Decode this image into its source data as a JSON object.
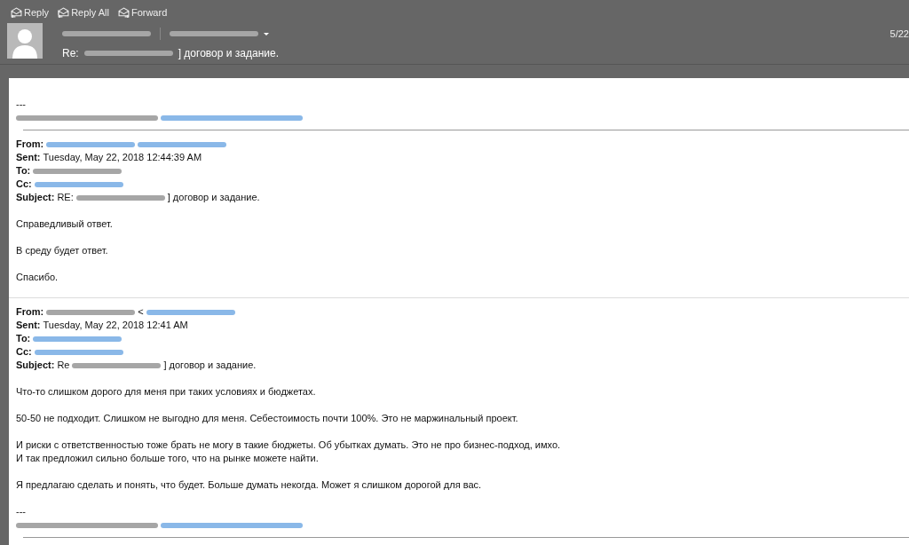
{
  "toolbar": {
    "actions": [
      {
        "label": "Reply",
        "kind": "reply"
      },
      {
        "label": "Reply All",
        "kind": "reply-all"
      },
      {
        "label": "Forward",
        "kind": "forward"
      }
    ]
  },
  "header": {
    "sender": {
      "color": "#a6a6a6"
    },
    "recipient": {
      "color": "#a6a6a6"
    },
    "subject": [
      {
        "kind": "text",
        "text": "Re:"
      },
      {
        "kind": "redacted",
        "color": "#a6a6a6"
      },
      {
        "kind": "text",
        "text": "] договор и задание."
      }
    ],
    "date": "5/22"
  },
  "signature_top": {
    "dashes": "---",
    "line": [
      {
        "kind": "redacted",
        "color": "#a6a6a6"
      },
      {
        "kind": "redacted",
        "color": "#8ab8e8"
      }
    ]
  },
  "messages": [
    {
      "fields": [
        {
          "label": "From:",
          "value": [
            {
              "kind": "redacted",
              "color": "#8ab8e8"
            },
            {
              "kind": "redacted",
              "color": "#8ab8e8"
            }
          ]
        },
        {
          "label": "Sent:",
          "value": [
            {
              "kind": "text",
              "text": "Tuesday, May 22, 2018 12:44:39 AM"
            }
          ]
        },
        {
          "label": "To:",
          "value": [
            {
              "kind": "redacted",
              "color": "#a6a6a6"
            }
          ]
        },
        {
          "label": "Cc:",
          "value": [
            {
              "kind": "redacted",
              "color": "#8ab8e8"
            }
          ]
        },
        {
          "label": "Subject:",
          "value": [
            {
              "kind": "text",
              "text": "RE:"
            },
            {
              "kind": "redacted",
              "color": "#a6a6a6"
            },
            {
              "kind": "text",
              "text": "] договор и задание."
            }
          ]
        }
      ],
      "paragraphs": [
        [
          "Справедливый ответ."
        ],
        [
          "В среду будет ответ."
        ],
        [
          "Спасибо."
        ]
      ]
    },
    {
      "fields": [
        {
          "label": "From:",
          "value": [
            {
              "kind": "redacted",
              "color": "#a6a6a6"
            },
            {
              "kind": "text",
              "text": "<"
            },
            {
              "kind": "redacted",
              "color": "#8ab8e8"
            }
          ]
        },
        {
          "label": "Sent:",
          "value": [
            {
              "kind": "text",
              "text": "Tuesday, May 22, 2018 12:41 AM"
            }
          ]
        },
        {
          "label": "To:",
          "value": [
            {
              "kind": "redacted",
              "color": "#8ab8e8"
            }
          ]
        },
        {
          "label": "Cc:",
          "value": [
            {
              "kind": "redacted",
              "color": "#8ab8e8"
            }
          ]
        },
        {
          "label": "Subject:",
          "value": [
            {
              "kind": "text",
              "text": "Re"
            },
            {
              "kind": "redacted",
              "color": "#a6a6a6"
            },
            {
              "kind": "text",
              "text": "] договор и задание."
            }
          ]
        }
      ],
      "paragraphs": [
        [
          "Что-то слишком дорого для меня при таких условиях и бюджетах."
        ],
        [
          "50-50 не подходит. Слишком не выгодно для меня. Себестоимость почти 100%. Это не маржинальный проект."
        ],
        [
          "И риски с ответственностью тоже брать не могу в такие бюджеты. Об убытках думать. Это не про бизнес-подход, имхо.",
          "И так предложил сильно больше того, что на рынке можете найти."
        ],
        [
          "Я предлагаю сделать и понять, что будет. Больше думать некогда. Может я слишком дорогой для вас."
        ]
      ],
      "signature": {
        "dashes": "---",
        "line": [
          {
            "kind": "redacted",
            "color": "#a6a6a6"
          },
          {
            "kind": "redacted",
            "color": "#8ab8e8"
          }
        ]
      }
    }
  ]
}
